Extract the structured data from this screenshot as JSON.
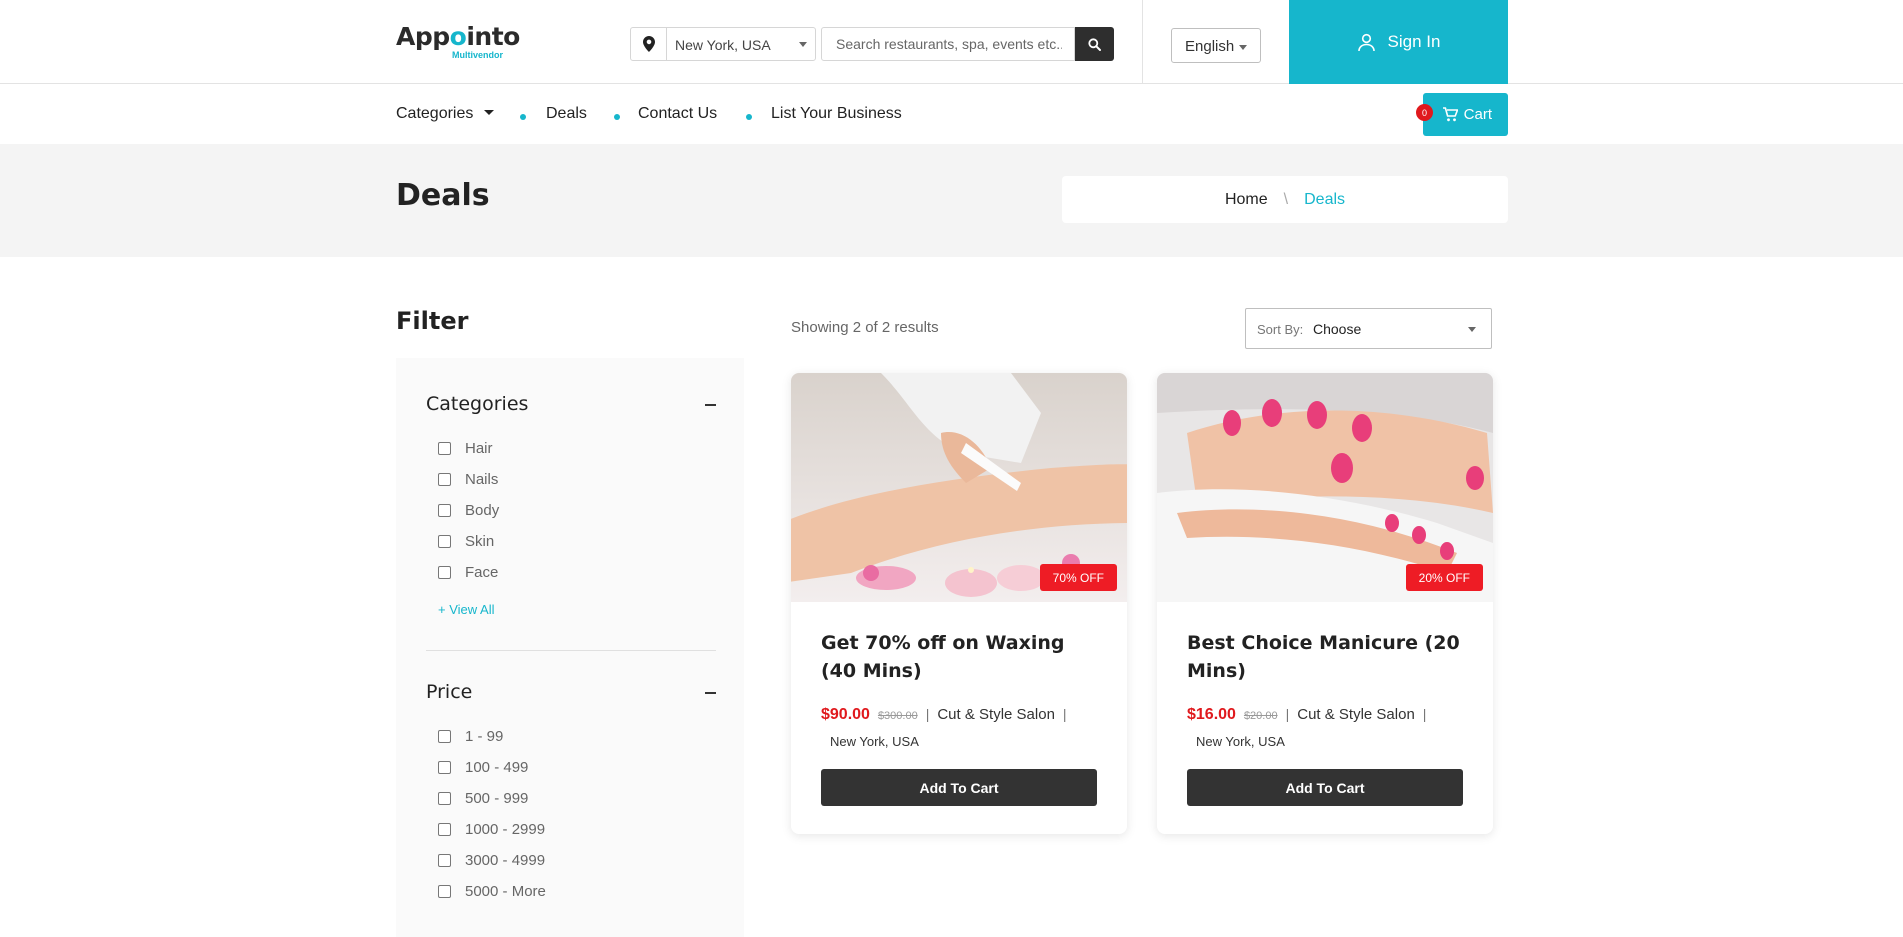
{
  "header": {
    "logo_prefix": "App",
    "logo_accent": "o",
    "logo_rest": "into",
    "logo_sub": "Multivendor",
    "location": "New York, USA",
    "search_placeholder": "Search restaurants, spa, events etc...",
    "language": "English",
    "signin_label": "Sign In"
  },
  "nav": {
    "items": [
      {
        "label": "Categories"
      },
      {
        "label": "Deals"
      },
      {
        "label": "Contact Us"
      },
      {
        "label": "List Your Business"
      }
    ],
    "cart_label": "Cart",
    "cart_count": "0"
  },
  "page": {
    "title": "Deals",
    "breadcrumb": {
      "home": "Home",
      "separator": "\\",
      "current": "Deals"
    }
  },
  "filter": {
    "title": "Filter",
    "categories": {
      "title": "Categories",
      "options": [
        "Hair",
        "Nails",
        "Body",
        "Skin",
        "Face"
      ],
      "view_all": "+ View All"
    },
    "price": {
      "title": "Price",
      "options": [
        "1 - 99",
        "100 - 499",
        "500 - 999",
        "1000 - 2999",
        "3000 - 4999",
        "5000 - More"
      ]
    }
  },
  "results": {
    "count_text": "Showing 2 of 2 results",
    "sort_label": "Sort By:",
    "sort_value": "Choose"
  },
  "deals": [
    {
      "title": "Get 70% off on Waxing (40 Mins)",
      "discount": "70% OFF",
      "price": "$90.00",
      "old_price": "$300.00",
      "salon": "Cut & Style Salon",
      "city": "New York, USA",
      "button": "Add To Cart",
      "image": "waxing-photo"
    },
    {
      "title": "Best Choice Manicure (20 Mins)",
      "discount": "20% OFF",
      "price": "$16.00",
      "old_price": "$20.00",
      "salon": "Cut & Style Salon",
      "city": "New York, USA",
      "button": "Add To Cart",
      "image": "manicure-photo"
    }
  ],
  "colors": {
    "accent": "#16b6cc",
    "price_red": "#e0191d",
    "badge_red": "#ee1c25",
    "dark_button": "#333333"
  }
}
